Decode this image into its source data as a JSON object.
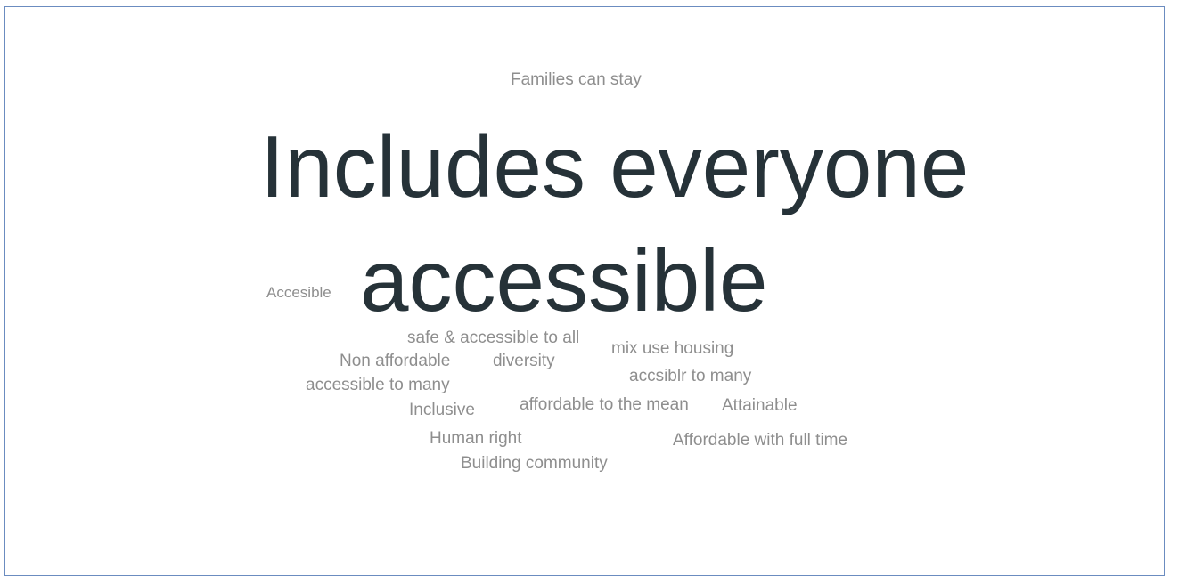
{
  "word_cloud": {
    "words": [
      {
        "text": "Families can stay",
        "weight": 1
      },
      {
        "text": "Includes everyone",
        "weight": 5
      },
      {
        "text": "Accesible",
        "weight": 1
      },
      {
        "text": "accessible",
        "weight": 5
      },
      {
        "text": "safe & accessible to all",
        "weight": 1
      },
      {
        "text": "mix use housing",
        "weight": 1
      },
      {
        "text": "Non affordable",
        "weight": 1
      },
      {
        "text": "diversity",
        "weight": 1
      },
      {
        "text": "accsiblr to many",
        "weight": 1
      },
      {
        "text": "accessible to many",
        "weight": 1
      },
      {
        "text": "Inclusive",
        "weight": 1
      },
      {
        "text": "affordable to the mean",
        "weight": 1
      },
      {
        "text": "Attainable",
        "weight": 1
      },
      {
        "text": "Human right",
        "weight": 1
      },
      {
        "text": "Affordable with full time",
        "weight": 1
      },
      {
        "text": "Building community",
        "weight": 1
      }
    ],
    "colors": {
      "emphasis": "#263238",
      "normal": "#8e8e8e",
      "frame_border": "#6b8cc0"
    }
  }
}
